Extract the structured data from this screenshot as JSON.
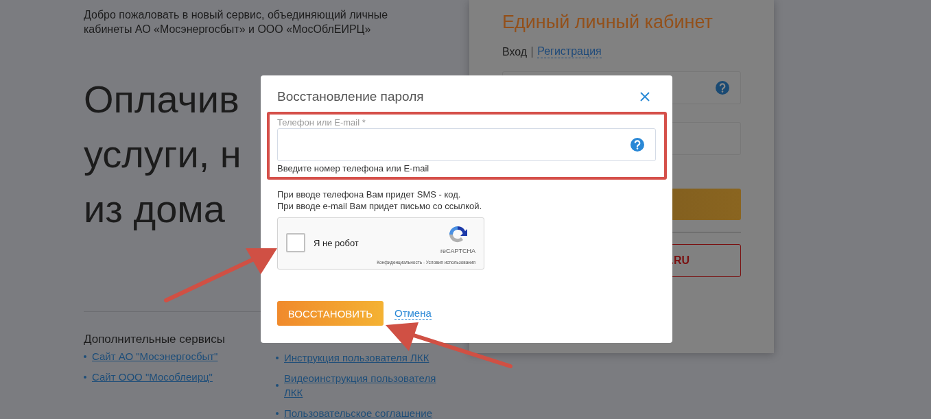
{
  "page": {
    "intro": "Добро пожаловать в новый сервис, объединяющий личные кабинеты АО «Мосэнергосбыт» и ООО «МосОблЕИРЦ»",
    "headline_lines": [
      "Оплачив",
      "услуги, н",
      "из дома"
    ],
    "footer": {
      "heading": "Дополнительные сервисы",
      "links_left": [
        "Сайт АО \"Мосэнергосбыт\"",
        "Сайт ООО \"Мособлеирц\""
      ],
      "links_right": [
        "Инструкция пользователя ЛКК",
        "Видеоинструкция пользователя ЛКК",
        "Пользовательское соглашение"
      ]
    }
  },
  "login_panel": {
    "title": "Единый личный кабинет",
    "tabs": [
      {
        "label": "Вход",
        "selected": true
      },
      {
        "label": "Регистрация",
        "selected": false
      }
    ],
    "outline_button": ".RU"
  },
  "dialog": {
    "title": "Восстановление пароля",
    "field": {
      "label": "Телефон или E-mail *",
      "hint": "Введите номер телефона или E-mail"
    },
    "info": [
      "При вводе телефона Вам придет SMS - код.",
      "При вводе e-mail Вам придет письмо со ссылкой."
    ],
    "captcha": {
      "label": "Я не робот",
      "checked": false,
      "brand": "reCAPTCHA",
      "links": "Конфиденциальность - Условия использования"
    },
    "submit": "ВОССТАНОВИТЬ",
    "cancel": "Отмена"
  }
}
